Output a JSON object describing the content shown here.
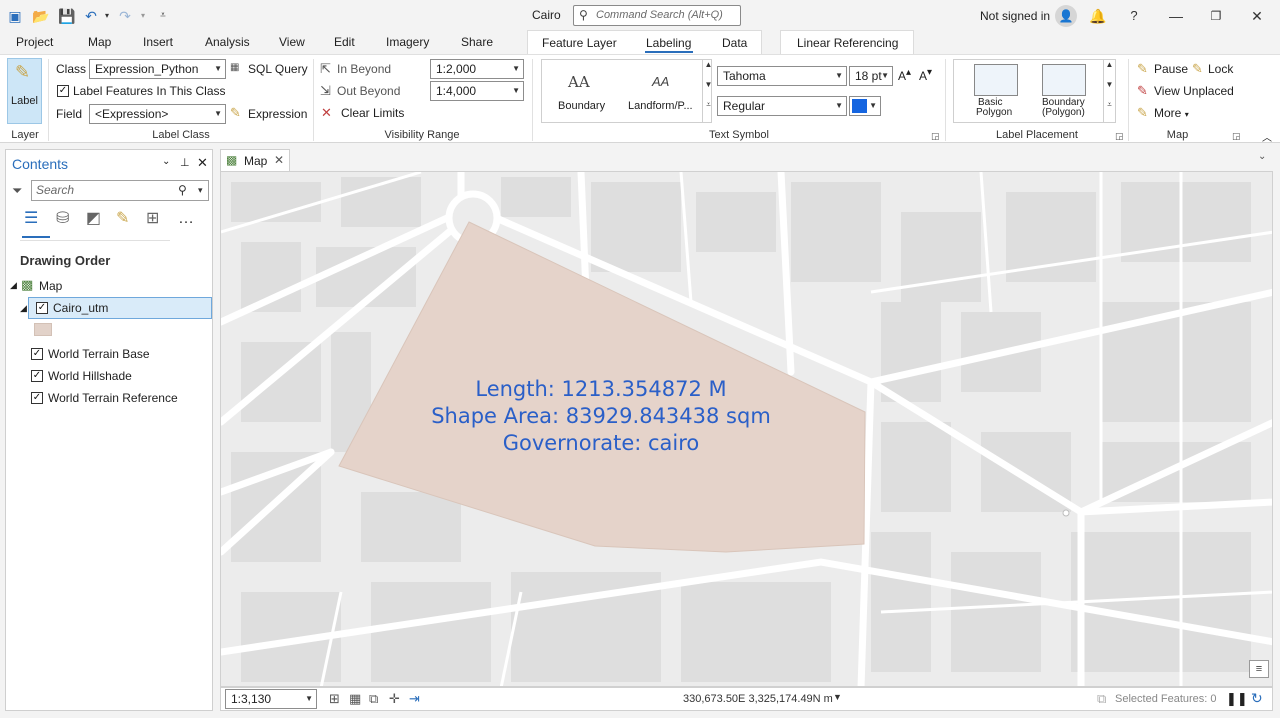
{
  "window": {
    "title": "Cairo",
    "command_search_placeholder": "Command Search (Alt+Q)",
    "signin": "Not signed in",
    "help": "?"
  },
  "menu_tabs": [
    "Project",
    "Map",
    "Insert",
    "Analysis",
    "View",
    "Edit",
    "Imagery",
    "Share"
  ],
  "context_tabs": [
    "Feature Layer",
    "Labeling",
    "Data"
  ],
  "active_context_tab": "Labeling",
  "linear_referencing": "Linear Referencing",
  "ribbon": {
    "layer": {
      "button": "Label",
      "group": "Layer"
    },
    "label_class": {
      "class_label": "Class",
      "class_value": "Expression_Python",
      "sql_query": "SQL Query",
      "label_features": "Label Features In This Class",
      "field_label": "Field",
      "field_value": "<Expression>",
      "expression": "Expression",
      "group": "Label Class"
    },
    "visibility_range": {
      "in_beyond": "In Beyond",
      "out_beyond": "Out Beyond",
      "clear_limits": "Clear Limits",
      "in_scale": "1:2,000",
      "out_scale": "1:4,000",
      "group": "Visibility Range"
    },
    "text_symbol": {
      "gallery": [
        {
          "glyph": "AA",
          "label": "Boundary"
        },
        {
          "glyph": "AA",
          "label": "Landform/P..."
        }
      ],
      "font": "Tahoma",
      "size": "18 pt",
      "style": "Regular",
      "color": "#1565e0",
      "group": "Text Symbol"
    },
    "label_placement": {
      "items": [
        {
          "line1": "Basic",
          "line2": "Polygon"
        },
        {
          "line1": "Boundary",
          "line2": "(Polygon)"
        }
      ],
      "group": "Label Placement"
    },
    "map": {
      "pause": "Pause",
      "lock": "Lock",
      "view_unplaced": "View Unplaced",
      "more": "More",
      "group": "Map"
    }
  },
  "contents": {
    "title": "Contents",
    "search_placeholder": "Search",
    "drawing_order": "Drawing Order",
    "map": "Map",
    "layers": [
      {
        "name": "Cairo_utm",
        "checked": true,
        "selected": true,
        "swatch": "#e2d2c9"
      },
      {
        "name": "World Terrain Base",
        "checked": true
      },
      {
        "name": "World Hillshade",
        "checked": true
      },
      {
        "name": "World Terrain Reference",
        "checked": true
      }
    ]
  },
  "map_view": {
    "tab": "Map",
    "polygon_fill": "#e5d3ca",
    "label_color": "#2a5fc8",
    "label_lines": [
      "Length: 1213.354872 M",
      "Shape Area: 83929.843438 sqm",
      "Governorate: cairo"
    ]
  },
  "status": {
    "scale": "1:3,130",
    "coordinates": "330,673.50E 3,325,174.49N m",
    "selected_features": "Selected Features: 0"
  }
}
